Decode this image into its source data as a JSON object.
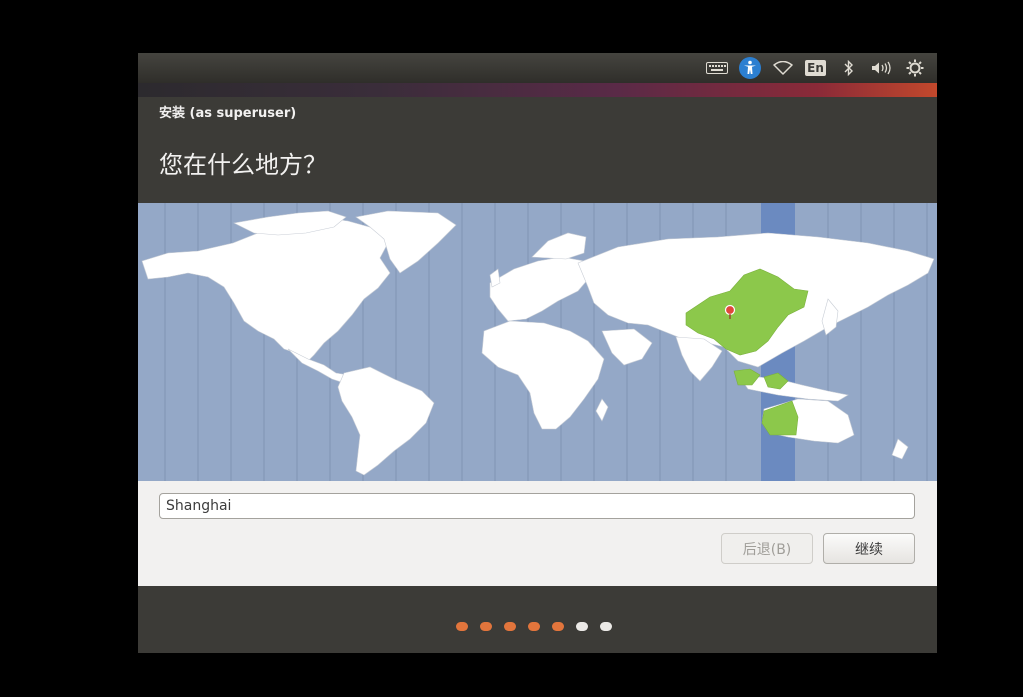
{
  "window": {
    "title": "安装 (as superuser)",
    "heading": "您在什么地方？"
  },
  "panel": {
    "keyboard_icon": "keyboard-icon",
    "accessibility_icon": "accessibility-icon",
    "wifi_icon": "wifi-icon",
    "language_label": "En",
    "bluetooth_icon": "bluetooth-icon",
    "volume_icon": "volume-icon",
    "settings_icon": "gear-icon"
  },
  "map": {
    "selected_city": "Shanghai",
    "highlight_color": "#8cc84b",
    "ocean_color": "#94a8c7",
    "land_color": "#ffffff"
  },
  "timezone": {
    "value": "Shanghai"
  },
  "buttons": {
    "back_label": "后退(B)",
    "continue_label": "继续"
  },
  "progress": {
    "total_steps": 7,
    "completed_steps": 5,
    "done_color": "#e2753c",
    "todo_color": "#ebe9e6"
  }
}
